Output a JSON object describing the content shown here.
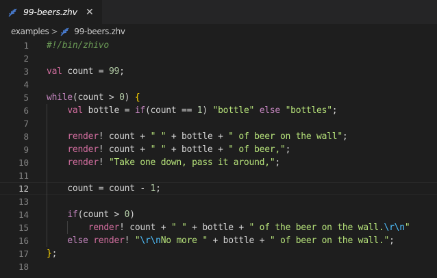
{
  "tab": {
    "filename": "99-beers.zhv",
    "close_glyph": "✕",
    "icon": "feather-quill-icon",
    "icon_color": "#4a7fd6"
  },
  "breadcrumb": {
    "folder": "examples",
    "separator": ">",
    "file": "99-beers.zhv"
  },
  "editor": {
    "current_line": 12,
    "lines": [
      {
        "n": "1",
        "tokens": [
          {
            "t": "#!/bin/zhivo",
            "c": "cmt"
          }
        ]
      },
      {
        "n": "2",
        "tokens": []
      },
      {
        "n": "3",
        "tokens": [
          {
            "t": "val",
            "c": "kw"
          },
          {
            "t": " count = ",
            "c": "pl"
          },
          {
            "t": "99",
            "c": "num"
          },
          {
            "t": ";",
            "c": "pl"
          }
        ]
      },
      {
        "n": "4",
        "tokens": []
      },
      {
        "n": "5",
        "tokens": [
          {
            "t": "while",
            "c": "ctl"
          },
          {
            "t": "(count > ",
            "c": "pl"
          },
          {
            "t": "0",
            "c": "num"
          },
          {
            "t": ") ",
            "c": "pl"
          },
          {
            "t": "{",
            "c": "br"
          }
        ]
      },
      {
        "n": "6",
        "tokens": [
          {
            "t": "    ",
            "c": "pl"
          },
          {
            "t": "val",
            "c": "kw"
          },
          {
            "t": " bottle = ",
            "c": "pl"
          },
          {
            "t": "if",
            "c": "ctl"
          },
          {
            "t": "(count == ",
            "c": "pl"
          },
          {
            "t": "1",
            "c": "num"
          },
          {
            "t": ") ",
            "c": "pl"
          },
          {
            "t": "\"bottle\"",
            "c": "str"
          },
          {
            "t": " ",
            "c": "pl"
          },
          {
            "t": "else",
            "c": "ctl"
          },
          {
            "t": " ",
            "c": "pl"
          },
          {
            "t": "\"bottles\"",
            "c": "str"
          },
          {
            "t": ";",
            "c": "pl"
          }
        ]
      },
      {
        "n": "7",
        "tokens": []
      },
      {
        "n": "8",
        "tokens": [
          {
            "t": "    ",
            "c": "pl"
          },
          {
            "t": "render",
            "c": "kw"
          },
          {
            "t": "! count + ",
            "c": "pl"
          },
          {
            "t": "\" \"",
            "c": "str"
          },
          {
            "t": " + bottle + ",
            "c": "pl"
          },
          {
            "t": "\" of beer on the wall\"",
            "c": "str"
          },
          {
            "t": ";",
            "c": "pl"
          }
        ]
      },
      {
        "n": "9",
        "tokens": [
          {
            "t": "    ",
            "c": "pl"
          },
          {
            "t": "render",
            "c": "kw"
          },
          {
            "t": "! count + ",
            "c": "pl"
          },
          {
            "t": "\" \"",
            "c": "str"
          },
          {
            "t": " + bottle + ",
            "c": "pl"
          },
          {
            "t": "\" of beer,\"",
            "c": "str"
          },
          {
            "t": ";",
            "c": "pl"
          }
        ]
      },
      {
        "n": "10",
        "tokens": [
          {
            "t": "    ",
            "c": "pl"
          },
          {
            "t": "render",
            "c": "kw"
          },
          {
            "t": "! ",
            "c": "pl"
          },
          {
            "t": "\"Take one down, pass it around,\"",
            "c": "str"
          },
          {
            "t": ";",
            "c": "pl"
          }
        ]
      },
      {
        "n": "11",
        "tokens": []
      },
      {
        "n": "12",
        "tokens": [
          {
            "t": "    count = count - ",
            "c": "pl"
          },
          {
            "t": "1",
            "c": "num"
          },
          {
            "t": ";",
            "c": "pl"
          }
        ]
      },
      {
        "n": "13",
        "tokens": []
      },
      {
        "n": "14",
        "tokens": [
          {
            "t": "    ",
            "c": "pl"
          },
          {
            "t": "if",
            "c": "ctl"
          },
          {
            "t": "(count > ",
            "c": "pl"
          },
          {
            "t": "0",
            "c": "num"
          },
          {
            "t": ")",
            "c": "pl"
          }
        ]
      },
      {
        "n": "15",
        "tokens": [
          {
            "t": "        ",
            "c": "pl"
          },
          {
            "t": "render",
            "c": "kw"
          },
          {
            "t": "! count + ",
            "c": "pl"
          },
          {
            "t": "\" \"",
            "c": "str"
          },
          {
            "t": " + bottle + ",
            "c": "pl"
          },
          {
            "t": "\" of the beer on the wall.",
            "c": "str"
          },
          {
            "t": "\\r\\n",
            "c": "esc"
          },
          {
            "t": "\"",
            "c": "str"
          }
        ]
      },
      {
        "n": "16",
        "tokens": [
          {
            "t": "    ",
            "c": "pl"
          },
          {
            "t": "else",
            "c": "ctl"
          },
          {
            "t": " ",
            "c": "pl"
          },
          {
            "t": "render",
            "c": "kw"
          },
          {
            "t": "! ",
            "c": "pl"
          },
          {
            "t": "\"",
            "c": "str"
          },
          {
            "t": "\\r\\n",
            "c": "esc"
          },
          {
            "t": "No more \"",
            "c": "str"
          },
          {
            "t": " + bottle + ",
            "c": "pl"
          },
          {
            "t": "\" of beer on the wall.\"",
            "c": "str"
          },
          {
            "t": ";",
            "c": "pl"
          }
        ]
      },
      {
        "n": "17",
        "tokens": [
          {
            "t": "}",
            "c": "br"
          },
          {
            "t": ";",
            "c": "pl"
          }
        ]
      },
      {
        "n": "18",
        "tokens": []
      }
    ]
  },
  "colors": {
    "background": "#1e1e1e",
    "tabbar": "#252526",
    "keyword": "#d16d9e",
    "control": "#c586c0",
    "number": "#b5cea8",
    "string": "#b6e27a",
    "escape": "#4fc1ff",
    "comment": "#6a9955",
    "bracket": "#ffd700"
  }
}
